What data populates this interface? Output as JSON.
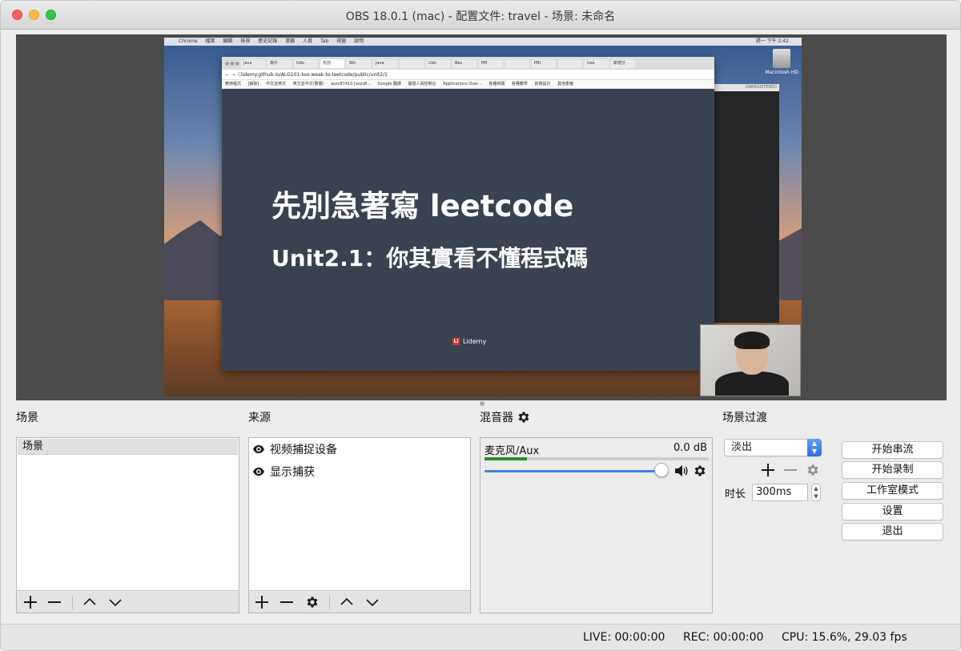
{
  "window": {
    "title": "OBS 18.0.1 (mac) - 配置文件: travel - 场景: 未命名"
  },
  "preview": {
    "mac_menubar": [
      "Chrome",
      "檔案",
      "編輯",
      "檢視",
      "歷史記錄",
      "書籤",
      "人員",
      "Tab",
      "視窗",
      "說明"
    ],
    "mac_clock": "週一 下午 2:42",
    "disk_label": "Macintosh HD",
    "editor_label": "UNREGISTERED",
    "browser": {
      "tabs": [
        "Java",
        "為什",
        "Udo",
        "先別",
        "Wri",
        "Java",
        "",
        "Udo",
        "Bes",
        "PM",
        "",
        "PRI",
        "",
        "Use",
        "新增分"
      ],
      "url": "lidemy.github.io/ALG101-too-weak-to-leetcode/public/unit2/1",
      "bookmarks": [
        "應用程式",
        "[解除]",
        "中文並英文",
        "英文並中文(繁體)",
        "aszx87410 [aszx8...",
        "Google 翻譯",
        "開發人員控制台",
        "Applications Over...",
        "各種新聞",
        "各種教學",
        "前端設計",
        "其他書籤"
      ]
    },
    "slide": {
      "title": "先別急著寫 leetcode",
      "subtitle": "Unit2.1：你其實看不懂程式碼",
      "brand_mark": "Li",
      "brand": "Lidemy"
    }
  },
  "docks": {
    "scenes_label": "场景",
    "sources_label": "来源",
    "mixer_label": "混音器",
    "transitions_label": "场景过渡"
  },
  "scenes": {
    "items": [
      "场景"
    ]
  },
  "sources": {
    "items": [
      "视频捕捉设备",
      "显示捕获"
    ]
  },
  "mixer": {
    "channel_name": "麦克风/Aux",
    "level_db": "0.0 dB",
    "meter_level": 0.19,
    "fader_level": 0.98
  },
  "transitions": {
    "selected": "淡出",
    "duration_label": "时长",
    "duration_value": "300ms"
  },
  "controls": {
    "start_streaming": "开始串流",
    "start_recording": "开始录制",
    "studio_mode": "工作室模式",
    "settings": "设置",
    "exit": "退出"
  },
  "status": {
    "live": "LIVE: 00:00:00",
    "rec": "REC: 00:00:00",
    "cpu": "CPU: 15.6%, 29.03 fps"
  },
  "colors": {
    "accent": "#3d84e0",
    "meter": "#2f8e2a",
    "slide_bg": "#3a4250"
  }
}
